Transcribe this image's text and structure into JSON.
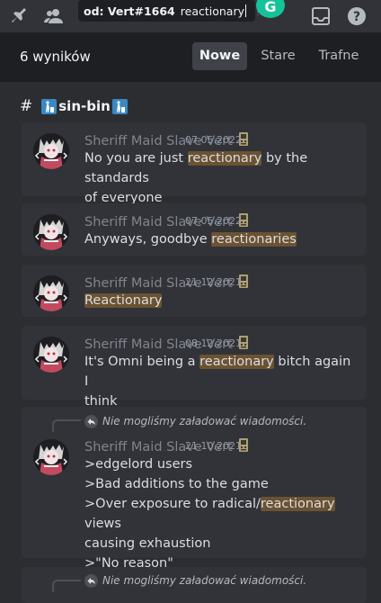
{
  "search": {
    "tag": "od: Vert#1664",
    "query": "reactionary"
  },
  "header": {
    "results_count": "6 wyników",
    "tabs": [
      "Nowe",
      "Stare",
      "Trafne"
    ],
    "active_tab": "Nowe"
  },
  "channel": {
    "hash": "#",
    "name": "sin-bin"
  },
  "reply_notice": "Nie mogliśmy załadować wiadomości.",
  "results": [
    {
      "author": "Sheriff Maid Slave Vert",
      "date": "07.05.2022",
      "lines": [
        [
          "No you are just ",
          {
            "hl": "reactionary"
          },
          " by the standards"
        ],
        [
          "of everyone"
        ]
      ]
    },
    {
      "author": "Sheriff Maid Slave Vert",
      "date": "07.05.2022",
      "lines": [
        [
          "Anyways, goodbye ",
          {
            "hl": "reactionaries"
          }
        ]
      ]
    },
    {
      "author": "Sheriff Maid Slave Vert",
      "date": "21.12.2021",
      "lines": [
        [
          {
            "hl": "Reactionary"
          }
        ]
      ]
    },
    {
      "author": "Sheriff Maid Slave Vert",
      "date": "08.12.2021",
      "lines": [
        [
          "It's Omni being a ",
          {
            "hl": "reactionary"
          },
          " bitch again I"
        ],
        [
          "think"
        ]
      ]
    },
    {
      "author": "Sheriff Maid Slave Vert",
      "date": "21.10.2021",
      "reply": true,
      "lines": [
        [
          ">edgelord users"
        ],
        [
          ">Bad additions to the game"
        ],
        [
          ">Over exposure to radical/",
          {
            "hl": "reactionary"
          },
          " views"
        ],
        [
          "causing exhaustion"
        ],
        [
          ">\"No reason\""
        ]
      ]
    }
  ]
}
